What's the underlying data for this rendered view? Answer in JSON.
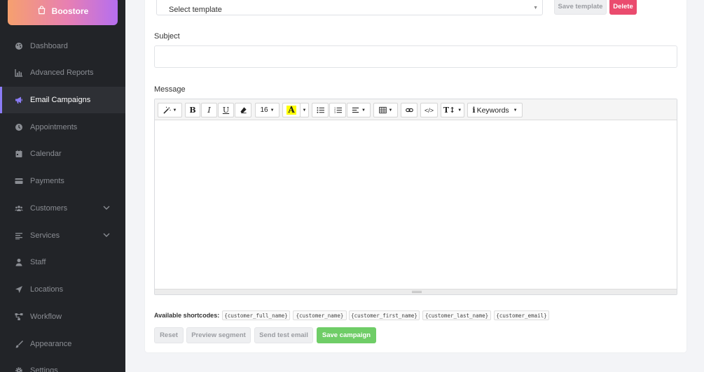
{
  "sidebar": {
    "brand": "Boostore",
    "items": [
      {
        "label": "Dashboard",
        "icon": "palette-icon"
      },
      {
        "label": "Advanced Reports",
        "icon": "chart-icon"
      },
      {
        "label": "Email Campaigns",
        "icon": "megaphone-icon",
        "active": true
      },
      {
        "label": "Appointments",
        "icon": "clock-icon"
      },
      {
        "label": "Calendar",
        "icon": "calendar-icon"
      },
      {
        "label": "Payments",
        "icon": "credit-card-icon"
      },
      {
        "label": "Customers",
        "icon": "users-icon",
        "expandable": true
      },
      {
        "label": "Services",
        "icon": "list-icon",
        "expandable": true
      },
      {
        "label": "Staff",
        "icon": "user-icon"
      },
      {
        "label": "Locations",
        "icon": "location-arrow-icon"
      },
      {
        "label": "Workflow",
        "icon": "workflow-icon"
      },
      {
        "label": "Appearance",
        "icon": "brush-icon"
      },
      {
        "label": "Settings",
        "icon": "gear-icon"
      }
    ]
  },
  "template": {
    "select_value": "Select template",
    "save_label": "Save template",
    "delete_label": "Delete"
  },
  "subject": {
    "label": "Subject",
    "value": ""
  },
  "message": {
    "label": "Message",
    "font_size": "16",
    "keywords_label": "Keywords"
  },
  "shortcodes": {
    "label": "Available shortcodes:",
    "items": [
      "{customer_full_name}",
      "{customer_name}",
      "{customer_first_name}",
      "{customer_last_name}",
      "{customer_email}"
    ]
  },
  "actions": {
    "reset": "Reset",
    "preview": "Preview segment",
    "test": "Send test email",
    "save": "Save campaign"
  },
  "colors": {
    "active_accent": "#8b7cf6",
    "delete": "#ea4b6e",
    "save": "#6fcd67",
    "sidebar_bg": "#222428"
  }
}
